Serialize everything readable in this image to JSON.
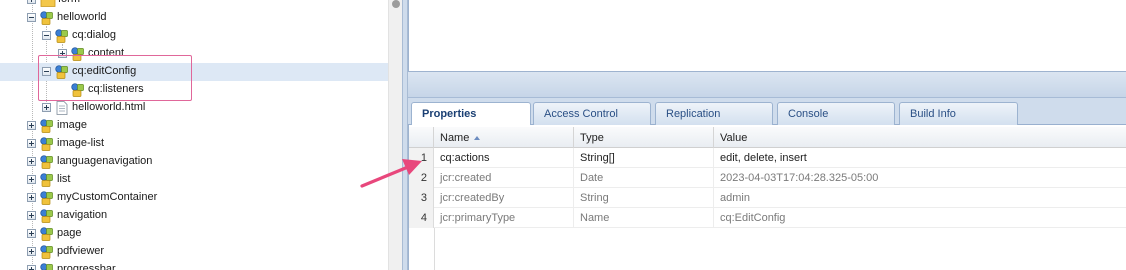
{
  "tree": {
    "items": [
      {
        "label": "form",
        "type": "folder"
      },
      {
        "label": "helloworld",
        "type": "component",
        "expanded": true
      },
      {
        "label": "cq:dialog",
        "type": "component",
        "expanded": true
      },
      {
        "label": "content",
        "type": "component"
      },
      {
        "label": "cq:editConfig",
        "type": "component",
        "expanded": true,
        "selected": true
      },
      {
        "label": "cq:listeners",
        "type": "component"
      },
      {
        "label": "helloworld.html",
        "type": "file"
      },
      {
        "label": "image",
        "type": "component"
      },
      {
        "label": "image-list",
        "type": "component"
      },
      {
        "label": "languagenavigation",
        "type": "component"
      },
      {
        "label": "list",
        "type": "component"
      },
      {
        "label": "myCustomContainer",
        "type": "component"
      },
      {
        "label": "navigation",
        "type": "component"
      },
      {
        "label": "page",
        "type": "component"
      },
      {
        "label": "pdfviewer",
        "type": "component"
      },
      {
        "label": "progressbar",
        "type": "component"
      }
    ]
  },
  "tabs": [
    {
      "label": "Properties",
      "active": true
    },
    {
      "label": "Access Control"
    },
    {
      "label": "Replication"
    },
    {
      "label": "Console"
    },
    {
      "label": "Build Info"
    }
  ],
  "grid": {
    "columns": {
      "name": "Name",
      "type": "Type",
      "value": "Value"
    },
    "rows": [
      {
        "num": "1",
        "name": "cq:actions",
        "type": "String[]",
        "value": "edit, delete, insert"
      },
      {
        "num": "2",
        "name": "jcr:created",
        "type": "Date",
        "value": "2023-04-03T17:04:28.325-05:00"
      },
      {
        "num": "3",
        "name": "jcr:createdBy",
        "type": "String",
        "value": "admin"
      },
      {
        "num": "4",
        "name": "jcr:primaryType",
        "type": "Name",
        "value": "cq:EditConfig"
      }
    ]
  },
  "colors": {
    "selection": "#dde8f5",
    "annotation": "#e0679a",
    "tab_text": "#2a4f85"
  }
}
